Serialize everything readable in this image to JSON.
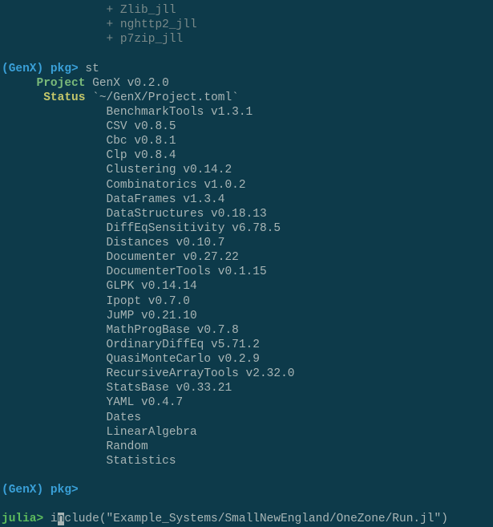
{
  "added_items": [
    "+ Zlib_jll",
    "+ nghttp2_jll",
    "+ p7zip_jll"
  ],
  "pkg_prompt": "(GenX) pkg>",
  "julia_prompt": "julia>",
  "status_cmd": " st",
  "project_label": "Project",
  "project_value": "GenX v0.2.0",
  "status_label": "Status",
  "status_value": "`~/GenX/Project.toml`",
  "packages": [
    "BenchmarkTools v1.3.1",
    "CSV v0.8.5",
    "Cbc v0.8.1",
    "Clp v0.8.4",
    "Clustering v0.14.2",
    "Combinatorics v1.0.2",
    "DataFrames v1.3.4",
    "DataStructures v0.18.13",
    "DiffEqSensitivity v6.78.5",
    "Distances v0.10.7",
    "Documenter v0.27.22",
    "DocumenterTools v0.1.15",
    "GLPK v0.14.14",
    "Ipopt v0.7.0",
    "JuMP v0.21.10",
    "MathProgBase v0.7.8",
    "OrdinaryDiffEq v5.71.2",
    "QuasiMonteCarlo v0.2.9",
    "RecursiveArrayTools v2.32.0",
    "StatsBase v0.33.21",
    "YAML v0.4.7",
    "Dates",
    "LinearAlgebra",
    "Random",
    "Statistics"
  ],
  "julia_cmd_prefix": "i",
  "julia_cmd_cursor_char": "n",
  "julia_cmd_suffix": "clude(\"Example_Systems/SmallNewEngland/OneZone/Run.jl\")"
}
